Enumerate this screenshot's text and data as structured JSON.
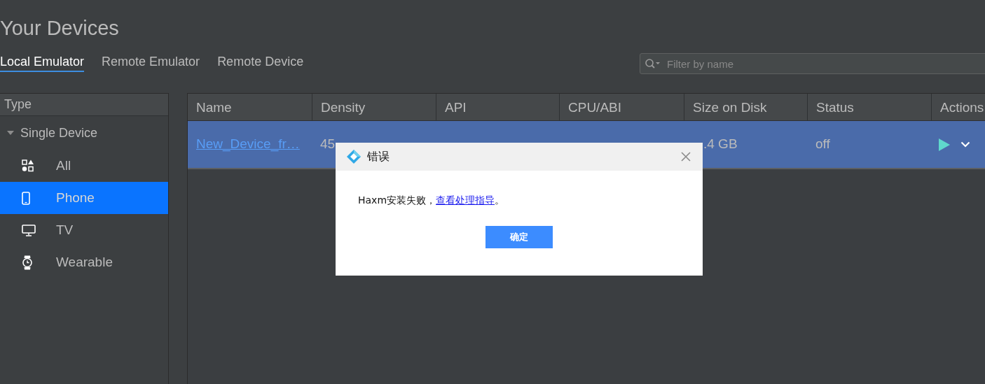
{
  "title": "Your Devices",
  "tabs": [
    {
      "label": "Local Emulator",
      "selected": true
    },
    {
      "label": "Remote Emulator",
      "selected": false
    },
    {
      "label": "Remote Device",
      "selected": false
    }
  ],
  "search": {
    "placeholder": "Filter by name"
  },
  "sidebar": {
    "header": "Type",
    "tree": [
      {
        "label": "Single Device",
        "expanded": true,
        "children": [
          {
            "label": "All",
            "kind": "all",
            "selected": false
          },
          {
            "label": "Phone",
            "kind": "phone",
            "selected": true
          },
          {
            "label": "TV",
            "kind": "tv",
            "selected": false
          },
          {
            "label": "Wearable",
            "kind": "wearable",
            "selected": false
          }
        ]
      }
    ]
  },
  "table": {
    "columns": [
      "Name",
      "Density",
      "API",
      "CPU/ABI",
      "Size on Disk",
      "Status",
      "Actions"
    ],
    "rows": [
      {
        "selected": true,
        "name": "New_Device_fr…",
        "density": "45",
        "size_on_disk": ".4 GB",
        "status": "off"
      }
    ]
  },
  "dialog": {
    "title": "错误",
    "message": "Haxm安装失败，",
    "link": "查看处理指导",
    "message_end": "。",
    "button": "确定"
  }
}
